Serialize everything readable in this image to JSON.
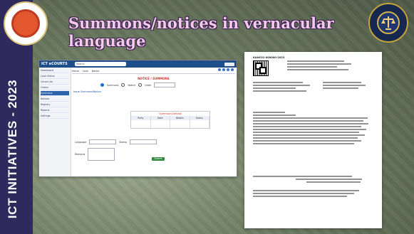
{
  "slide": {
    "title": "Summons/notices in vernacular language",
    "vertical_title": "ICT INITIATIVES - 2023",
    "left_logo_text": "HIGH COURT OF KARNATAKA"
  },
  "screenshot": {
    "app_name": "ICT eCOURTS",
    "search_placeholder": "Search",
    "tabs": [
      "Home",
      "Case",
      "Notice"
    ],
    "heading": "NOTICE / SUMMONS",
    "radio_labels": [
      "Summons",
      "Notice",
      "Order"
    ],
    "link_text": "Issue Summons/Notice",
    "table": {
      "caption": "Summons Details",
      "headers": [
        "Party",
        "Date",
        "Details",
        "Status"
      ]
    },
    "form_labels": [
      "Language",
      "Stamp",
      "Remarks"
    ],
    "submit": "Submit",
    "sidebar_items": [
      "Dashboard",
      "Case Status",
      "Cause List",
      "Orders",
      "Summons",
      "Notices",
      "Registry",
      "Reports",
      "Settings"
    ]
  },
  "document": {
    "id_text": "KAHC01-000000-2023"
  },
  "colors": {
    "left_band": "#2f2a5e",
    "title": "#f3c9f0",
    "ecourt_header": "#1f4f8b"
  }
}
